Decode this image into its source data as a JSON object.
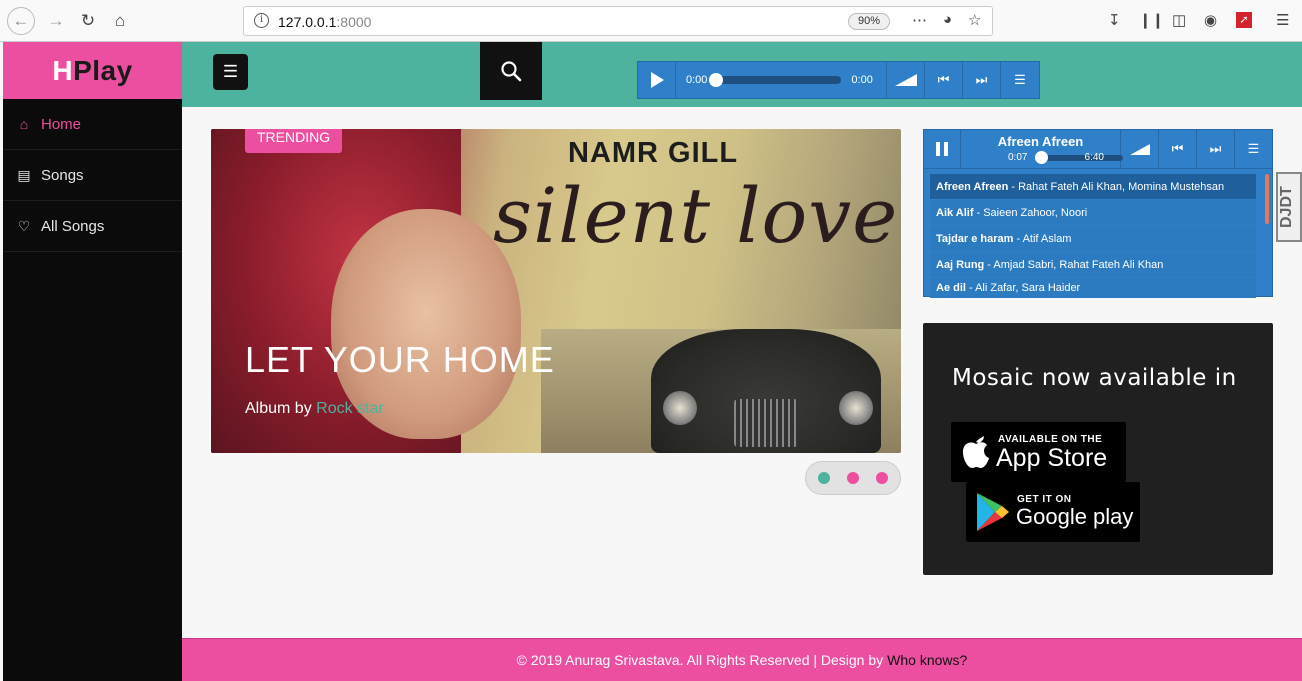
{
  "browser": {
    "url_host": "127.0.0.1",
    "url_port": ":8000",
    "zoom": "90%"
  },
  "sidebar": {
    "logo_h": "H",
    "logo_rest": "Play",
    "items": [
      {
        "label": "Home",
        "icon": "home-icon"
      },
      {
        "label": "Songs",
        "icon": "radio-icon"
      },
      {
        "label": "All Songs",
        "icon": "heart-icon"
      }
    ]
  },
  "top_player": {
    "current_time": "0:00",
    "duration": "0:00",
    "progress": 0
  },
  "hero": {
    "badge": "TRENDING",
    "artist": "NAMR GILL",
    "album_title": "silent love",
    "heading": "LET YOUR HOME",
    "sub_prefix": "Album by",
    "sub_link": "Rock star"
  },
  "playlist": {
    "now_playing": "Afreen Afreen",
    "current_time": "0:07",
    "duration": "6:40",
    "progress": 0.02,
    "tracks": [
      {
        "title": "Afreen Afreen",
        "artist": "- Rahat Fateh Ali Khan, Momina Mustehsan"
      },
      {
        "title": "Aik Alif",
        "artist": "- Saieen Zahoor, Noori"
      },
      {
        "title": "Tajdar e haram",
        "artist": "- Atif Aslam"
      },
      {
        "title": "Aaj Rung",
        "artist": "- Amjad Sabri, Rahat Fateh Ali Khan"
      },
      {
        "title": "Ae dil",
        "artist": "- Ali Zafar, Sara Haider"
      }
    ]
  },
  "extension_badge": "DJDT",
  "apps": {
    "title": "Mosaic now available in",
    "appstore_small": "AVAILABLE ON THE",
    "appstore_big": "App Store",
    "gplay_small": "GET IT ON",
    "gplay_big": "Google play"
  },
  "footer": {
    "text": "© 2019 Anurag Srivastava. All Rights Reserved | Design by",
    "link": "Who knows?"
  },
  "colors": {
    "accent_pink": "#ec4fa0",
    "accent_teal": "#4db39f",
    "player_blue": "#2f80c8"
  }
}
